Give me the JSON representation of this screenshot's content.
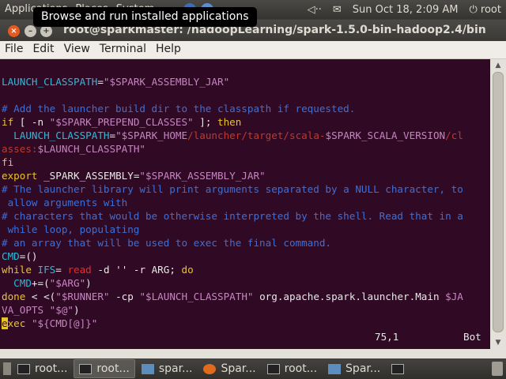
{
  "top_panel": {
    "menus": [
      "Applications",
      "Places",
      "System"
    ],
    "volume_icon": "speaker-icon",
    "mail_icon": "envelope-icon",
    "clock": "Sun Oct 18,  2:09 AM",
    "user": "root"
  },
  "tooltip": "Browse and run installed applications",
  "window": {
    "title": "root@sparkmaster: /hadoopLearning/spark-1.5.0-bin-hadoop2.4/bin",
    "menus": [
      "File",
      "Edit",
      "View",
      "Terminal",
      "Help"
    ]
  },
  "terminal": {
    "lines": [
      [
        {
          "c": "c-var",
          "t": "LAUNCH_CLASSPATH"
        },
        {
          "c": "c-white",
          "t": "="
        },
        {
          "c": "c-string",
          "t": "\"$SPARK_ASSEMBLY_JAR\""
        }
      ],
      [],
      [
        {
          "c": "c-comment",
          "t": "# Add the launcher build dir to the classpath if requested."
        }
      ],
      [
        {
          "c": "c-yellow",
          "t": "if"
        },
        {
          "c": "c-white",
          "t": " [ -n "
        },
        {
          "c": "c-string",
          "t": "\"$SPARK_PREPEND_CLASSES\""
        },
        {
          "c": "c-white",
          "t": " ]; "
        },
        {
          "c": "c-yellow",
          "t": "then"
        }
      ],
      [
        {
          "c": "c-white",
          "t": "  "
        },
        {
          "c": "c-var",
          "t": "LAUNCH_CLASSPATH"
        },
        {
          "c": "c-white",
          "t": "="
        },
        {
          "c": "c-string",
          "t": "\"$SPARK_HOME"
        },
        {
          "c": "c-path",
          "t": "/launcher/target/scala-"
        },
        {
          "c": "c-string",
          "t": "$SPARK_SCALA_VERSION"
        },
        {
          "c": "c-path",
          "t": "/cl"
        }
      ],
      [
        {
          "c": "c-path",
          "t": "asses:"
        },
        {
          "c": "c-string",
          "t": "$LAUNCH_CLASSPATH\""
        }
      ],
      [
        {
          "c": "c-yellow",
          "t": "fi"
        }
      ],
      [
        {
          "c": "c-yellow",
          "t": "export"
        },
        {
          "c": "c-white",
          "t": " _SPARK_ASSEMBLY="
        },
        {
          "c": "c-string",
          "t": "\"$SPARK_ASSEMBLY_JAR\""
        }
      ],
      [
        {
          "c": "c-comment",
          "t": "# The launcher library will print arguments separated by a NULL character, to"
        }
      ],
      [
        {
          "c": "c-comment",
          "t": " allow arguments with"
        }
      ],
      [
        {
          "c": "c-comment",
          "t": "# characters that would be otherwise interpreted by the shell. Read that in a"
        }
      ],
      [
        {
          "c": "c-comment",
          "t": " while loop, populating"
        }
      ],
      [
        {
          "c": "c-comment",
          "t": "# an array that will be used to exec the final command."
        }
      ],
      [
        {
          "c": "c-var",
          "t": "CMD"
        },
        {
          "c": "c-white",
          "t": "=()"
        }
      ],
      [
        {
          "c": "c-yellow",
          "t": "while"
        },
        {
          "c": "c-white",
          "t": " "
        },
        {
          "c": "c-var",
          "t": "IFS"
        },
        {
          "c": "c-white",
          "t": "= "
        },
        {
          "c": "c-red",
          "t": "read"
        },
        {
          "c": "c-white",
          "t": " -d '' -r ARG; "
        },
        {
          "c": "c-yellow",
          "t": "do"
        }
      ],
      [
        {
          "c": "c-white",
          "t": "  "
        },
        {
          "c": "c-var",
          "t": "CMD"
        },
        {
          "c": "c-white",
          "t": "+=("
        },
        {
          "c": "c-string",
          "t": "\"$ARG\""
        },
        {
          "c": "c-white",
          "t": ")"
        }
      ],
      [
        {
          "c": "c-yellow",
          "t": "done"
        },
        {
          "c": "c-white",
          "t": " < <("
        },
        {
          "c": "c-string",
          "t": "\"$RUNNER\""
        },
        {
          "c": "c-white",
          "t": " -cp "
        },
        {
          "c": "c-string",
          "t": "\"$LAUNCH_CLASSPATH\""
        },
        {
          "c": "c-white",
          "t": " org.apache.spark.launcher.Main "
        },
        {
          "c": "c-string",
          "t": "$JA"
        }
      ],
      [
        {
          "c": "c-string",
          "t": "VA_OPTS"
        },
        {
          "c": "c-white",
          "t": " "
        },
        {
          "c": "c-string",
          "t": "\"$@\""
        },
        {
          "c": "c-white",
          "t": ")"
        }
      ],
      [
        {
          "c": "cursor",
          "t": "e"
        },
        {
          "c": "c-yellow",
          "t": "xec"
        },
        {
          "c": "c-white",
          "t": " "
        },
        {
          "c": "c-string",
          "t": "\"${CMD[@]}\""
        }
      ]
    ],
    "cursor_position": "75,1",
    "scroll_position": "Bot"
  },
  "taskbar": {
    "items": [
      {
        "label": "root...",
        "icon": "terminal-icon",
        "active": false
      },
      {
        "label": "root...",
        "icon": "terminal-icon",
        "active": true
      },
      {
        "label": "spar...",
        "icon": "java-icon",
        "active": false
      },
      {
        "label": "Spar...",
        "icon": "firefox-icon",
        "active": false
      },
      {
        "label": "root...",
        "icon": "terminal-icon",
        "active": false
      },
      {
        "label": "Spar...",
        "icon": "java-icon",
        "active": false
      },
      {
        "label": "",
        "icon": "terminal-icon",
        "active": false
      }
    ]
  }
}
